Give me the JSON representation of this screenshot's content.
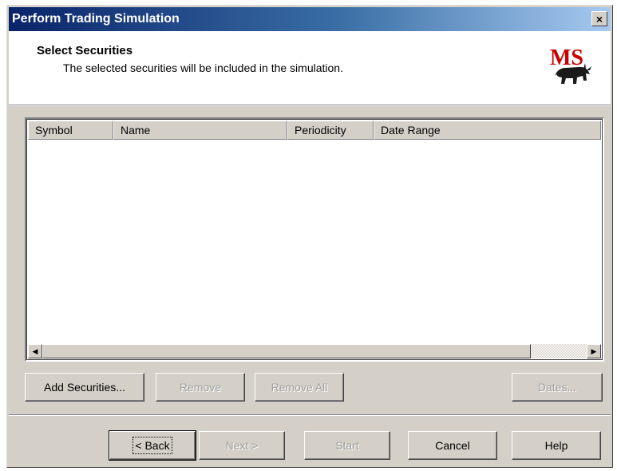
{
  "window": {
    "title": "Perform Trading Simulation",
    "close_glyph": "×"
  },
  "header": {
    "title": "Select Securities",
    "subtitle": "The selected securities will be included in the simulation.",
    "logo_icon": "ms-bull-logo-icon",
    "logo_text": "MS"
  },
  "list": {
    "columns": [
      {
        "label": "Symbol"
      },
      {
        "label": "Name"
      },
      {
        "label": "Periodicity"
      },
      {
        "label": "Date Range"
      }
    ],
    "rows": [],
    "scroll_left_glyph": "◀",
    "scroll_right_glyph": "▶"
  },
  "actions": {
    "add_securities": "Add Securities...",
    "remove": "Remove",
    "remove_all": "Remove All",
    "dates": "Dates..."
  },
  "nav": {
    "back": "< Back",
    "next": "Next >",
    "start": "Start",
    "cancel": "Cancel",
    "help": "Help"
  },
  "colors": {
    "face": "#d4d0c8",
    "title_start": "#0a246a",
    "title_end": "#a6caf0",
    "logo_red": "#cc0000"
  }
}
